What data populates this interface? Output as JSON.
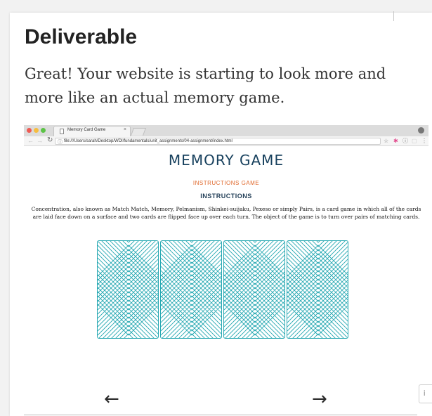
{
  "heading": "Deliverable",
  "lead_text": "Great! Your website is starting to look more and more like an actual memory game.",
  "browser": {
    "tab_title": "Memory Card Game",
    "tab_close": "×",
    "url": "file:///Users/sarah/Desktop/WDI/fundamentals/unit_assignments/04-assignment/index.html",
    "traffic_lights": [
      "#ee5b54",
      "#f5bd40",
      "#5cc346"
    ],
    "star": "☆"
  },
  "game_page": {
    "title": "MEMORY GAME",
    "subtitle_orange": "INSTRUCTIONS GAME",
    "subtitle_navy": "INSTRUCTIONS",
    "description": "Concentration, also known as Match Match, Memory, Pelmanism, Shinkei-suijaku, Pexeso or simply Pairs, is a card game in which all of the cards are laid face down on a surface and two cards are flipped face up over each turn. The object of the game is to turn over pairs of matching cards.",
    "card_count": 4,
    "card_color": "#26a8b2",
    "title_color": "#18415e",
    "accent_color": "#e06a2e"
  },
  "nav": {
    "prev_arrow": "←",
    "next_arrow": "→"
  },
  "side_badge_text": "i"
}
